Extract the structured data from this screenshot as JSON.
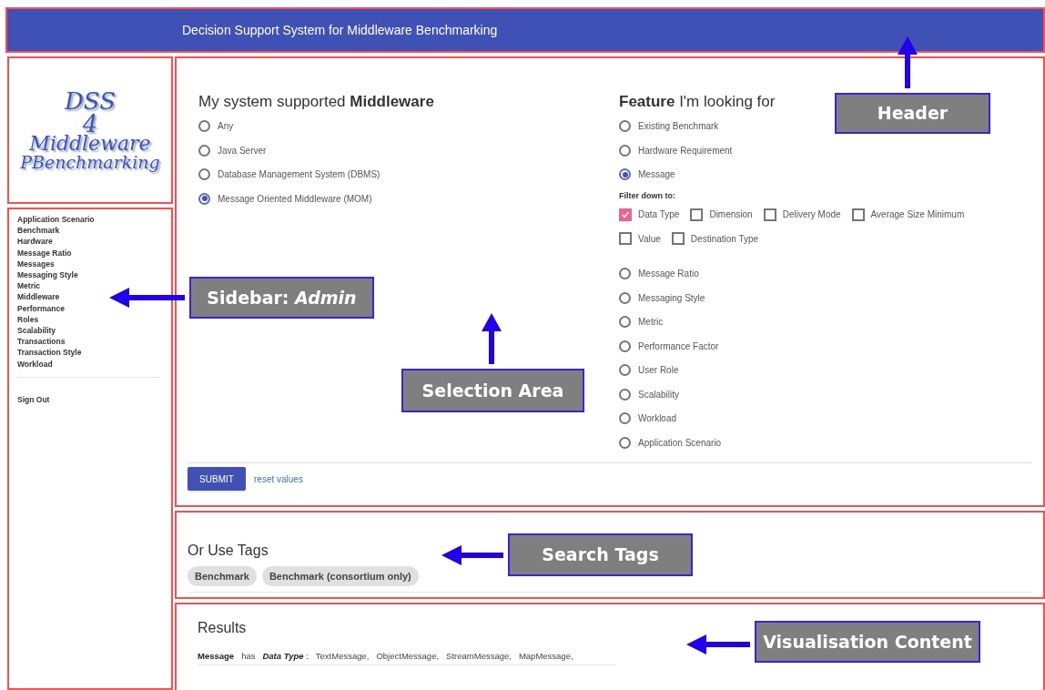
{
  "header": {
    "title": "Decision Support System for Middleware Benchmarking"
  },
  "logo": {
    "lines": [
      "DSS",
      "4",
      "Middleware",
      "PBenchmarking"
    ]
  },
  "sidebar": {
    "items": [
      "Application Scenario",
      "Benchmark",
      "Hardware",
      "Message Ratio",
      "Messages",
      "Messaging Style",
      "Metric",
      "Middleware",
      "Performance",
      "Roles",
      "Scalability",
      "Transactions",
      "Transaction Style",
      "Workload"
    ],
    "sign_out": "Sign Out"
  },
  "middleware": {
    "heading": "My system supported **Middleware**",
    "options": [
      {
        "label": "Any",
        "selected": false
      },
      {
        "label": "Java Server",
        "selected": false
      },
      {
        "label": "Database Management System (DBMS)",
        "selected": false
      },
      {
        "label": "Message Oriented Middleware (MOM)",
        "selected": true
      }
    ]
  },
  "feature": {
    "heading": "**Feature** I'm looking for",
    "options": [
      {
        "kind": "radio",
        "label": "Existing Benchmark",
        "selected": false
      },
      {
        "kind": "radio",
        "label": "Hardware Requirement",
        "selected": false
      },
      {
        "kind": "radio",
        "label": "Message",
        "selected": true
      },
      {
        "kind": "filter",
        "title": "Filter down to:",
        "options": [
          {
            "label": "Data Type",
            "checked": true
          },
          {
            "label": "Dimension",
            "checked": false
          },
          {
            "label": "Delivery Mode",
            "checked": false
          },
          {
            "label": "Average Size Minimum",
            "checked": false
          },
          {
            "label": "Value",
            "checked": false
          },
          {
            "label": "Destination Type",
            "checked": false
          }
        ]
      },
      {
        "kind": "radio",
        "label": "Message Ratio",
        "selected": false
      },
      {
        "kind": "radio",
        "label": "Messaging Style",
        "selected": false
      },
      {
        "kind": "radio",
        "label": "Metric",
        "selected": false
      },
      {
        "kind": "radio",
        "label": "Performance Factor",
        "selected": false
      },
      {
        "kind": "radio",
        "label": "User Role",
        "selected": false
      },
      {
        "kind": "radio",
        "label": "Scalability",
        "selected": false
      },
      {
        "kind": "radio",
        "label": "Workload",
        "selected": false
      },
      {
        "kind": "radio",
        "label": "Application Scenario",
        "selected": false
      }
    ]
  },
  "buttons": {
    "submit": "SUBMIT",
    "reset": "reset values"
  },
  "tags": {
    "heading": "Or Use Tags",
    "items": [
      "Benchmark",
      "Benchmark (consortium only)"
    ]
  },
  "results": {
    "heading": "Results",
    "subject": "Message",
    "verb": "has",
    "attribute": "Data Type",
    "separator": ":",
    "values": [
      "TextMessage,",
      "ObjectMessage,",
      "StreamMessage,",
      "MapMessage,"
    ]
  },
  "annotations": [
    {
      "label": "Header"
    },
    {
      "label": "Sidebar: *Admin*"
    },
    {
      "label": "Selection Area"
    },
    {
      "label": "Search Tags"
    },
    {
      "label": "Visualisation Content"
    }
  ]
}
